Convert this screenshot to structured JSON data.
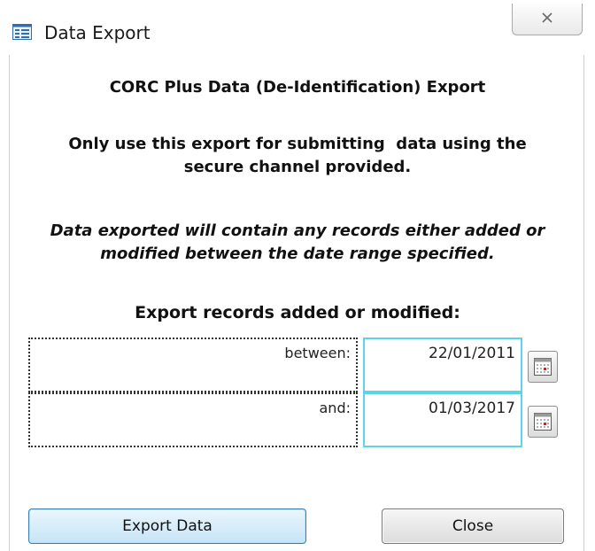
{
  "window": {
    "title": "Data Export",
    "close_glyph": "☒",
    "icon": "form-icon"
  },
  "content": {
    "heading": "CORC Plus Data (De-Identification) Export",
    "instruction_line1": "Only use this export for submitting  data using the",
    "instruction_line2": "secure channel provided.",
    "note_line1": "Data exported will contain any records either added or",
    "note_line2": "modified between the date range specified.",
    "range_heading": "Export records added or modified:"
  },
  "date_range": {
    "from_label": "between:",
    "from_value": "22/01/2011",
    "to_label": "and:",
    "to_value": "01/03/2017",
    "calendar_icon": "calendar-icon"
  },
  "buttons": {
    "export_label": "Export Data",
    "close_label": "Close"
  },
  "colors": {
    "field_border": "#5fd3e6",
    "default_button": "#c6e4f7"
  }
}
